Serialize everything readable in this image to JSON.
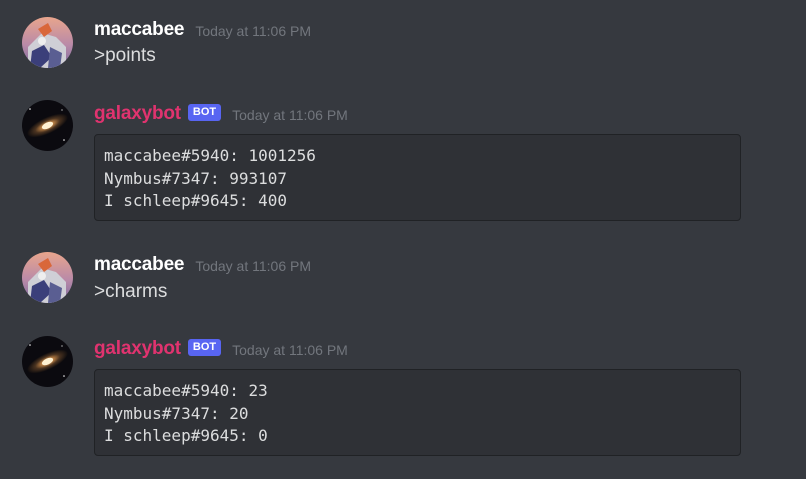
{
  "colors": {
    "background": "#36393f",
    "codeblock_bg": "#2f3136",
    "text": "#dcddde",
    "timestamp": "#72767d",
    "user_name": "#ffffff",
    "bot_name": "#e0336f",
    "bot_tag": "#5865f2"
  },
  "messages": [
    {
      "author": "maccabee",
      "avatar": "maccabee-avatar",
      "timestamp": "Today at 11:06 PM",
      "text": ">points"
    },
    {
      "author": "galaxybot",
      "bot_tag": "BOT",
      "avatar": "galaxy-avatar",
      "timestamp": "Today at 11:06 PM",
      "code_lines": [
        "maccabee#5940: 1001256",
        "Nymbus#7347: 993107",
        "I schleep#9645: 400"
      ]
    },
    {
      "author": "maccabee",
      "avatar": "maccabee-avatar",
      "timestamp": "Today at 11:06 PM",
      "text": ">charms"
    },
    {
      "author": "galaxybot",
      "bot_tag": "BOT",
      "avatar": "galaxy-avatar",
      "timestamp": "Today at 11:06 PM",
      "code_lines": [
        "maccabee#5940: 23",
        "Nymbus#7347: 20",
        "I schleep#9645: 0"
      ]
    }
  ]
}
